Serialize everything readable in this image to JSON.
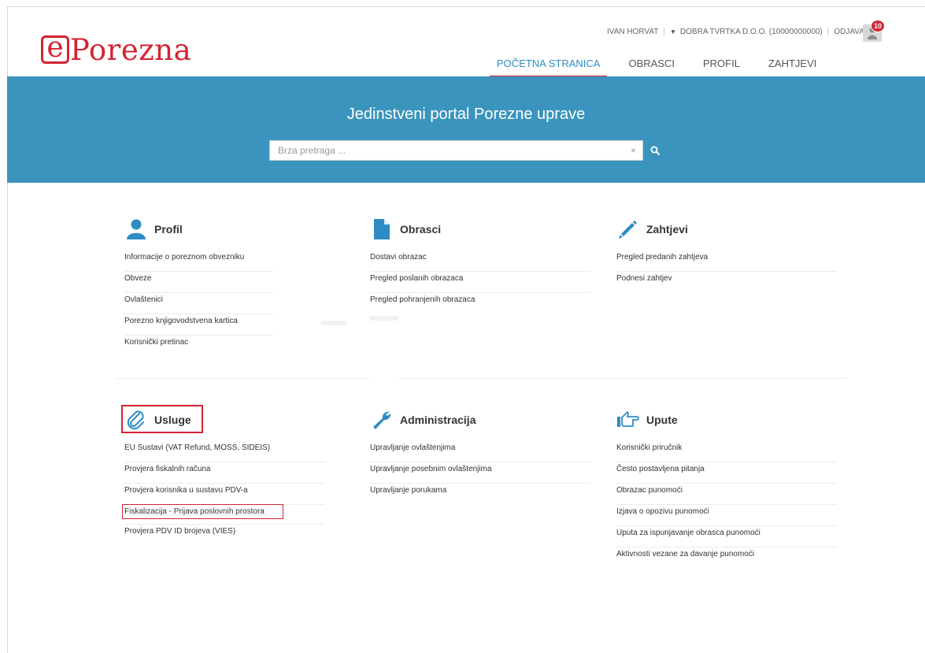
{
  "brand": {
    "logo_e": "e",
    "logo_text": "Porezna",
    "accent": "#d32432",
    "primary": "#3a94bd",
    "link_active": "#2e8cc4"
  },
  "userbar": {
    "user": "IVAN HORVAT",
    "company": "DOBRA TVRTKA D.O.O. (10000000000)",
    "logout": "ODJAVA",
    "notifications": "10"
  },
  "nav": {
    "tabs": [
      "POČETNA STRANICA",
      "OBRASCI",
      "PROFIL",
      "ZAHTJEVI"
    ],
    "active": 0
  },
  "banner": {
    "title": "Jedinstveni portal Porezne uprave",
    "search_placeholder": "Brza pretraga ...",
    "clear": "×"
  },
  "sections": [
    {
      "title": "Profil",
      "icon": "user-icon",
      "items": [
        "Informacije o poreznom obvezniku",
        "Obveze",
        "Ovlaštenici",
        "Porezno knjigovodstvena kartica",
        "Korisnički pretinac"
      ]
    },
    {
      "title": "Obrasci",
      "icon": "document-icon",
      "items": [
        "Dostavi obrazac",
        "Pregled poslanih obrazaca",
        "Pregled pohranjenih obrazaca"
      ]
    },
    {
      "title": "Zahtjevi",
      "icon": "pencil-icon",
      "items": [
        "Pregled predanih zahtjeva",
        "Podnesi zahtjev"
      ]
    },
    {
      "title": "Usluge",
      "icon": "paperclip-icon",
      "items": [
        "EU Sustavi (VAT Refund, MOSS, SIDEIS)",
        "Provjera fiskalnih računa",
        "Provjera korisnika u sustavu PDV-a",
        "Fiskalizacija - Prijava poslovnih prostora",
        "Provjera PDV ID brojeva (VIES)"
      ]
    },
    {
      "title": "Administracija",
      "icon": "wrench-icon",
      "items": [
        "Upravljanje ovlaštenjima",
        "Upravljanje posebnim ovlaštenjima",
        "Upravljanje porukama"
      ]
    },
    {
      "title": "Upute",
      "icon": "pointing-hand-icon",
      "items": [
        "Korisnički priručnik",
        "Često postavljena pitanja",
        "Obrazac punomoći",
        "Izjava o opozivu punomoći",
        "Uputa za ispunjavanje obrasca punomoći",
        "Aktivnosti vezane za davanje punomoći"
      ]
    }
  ]
}
